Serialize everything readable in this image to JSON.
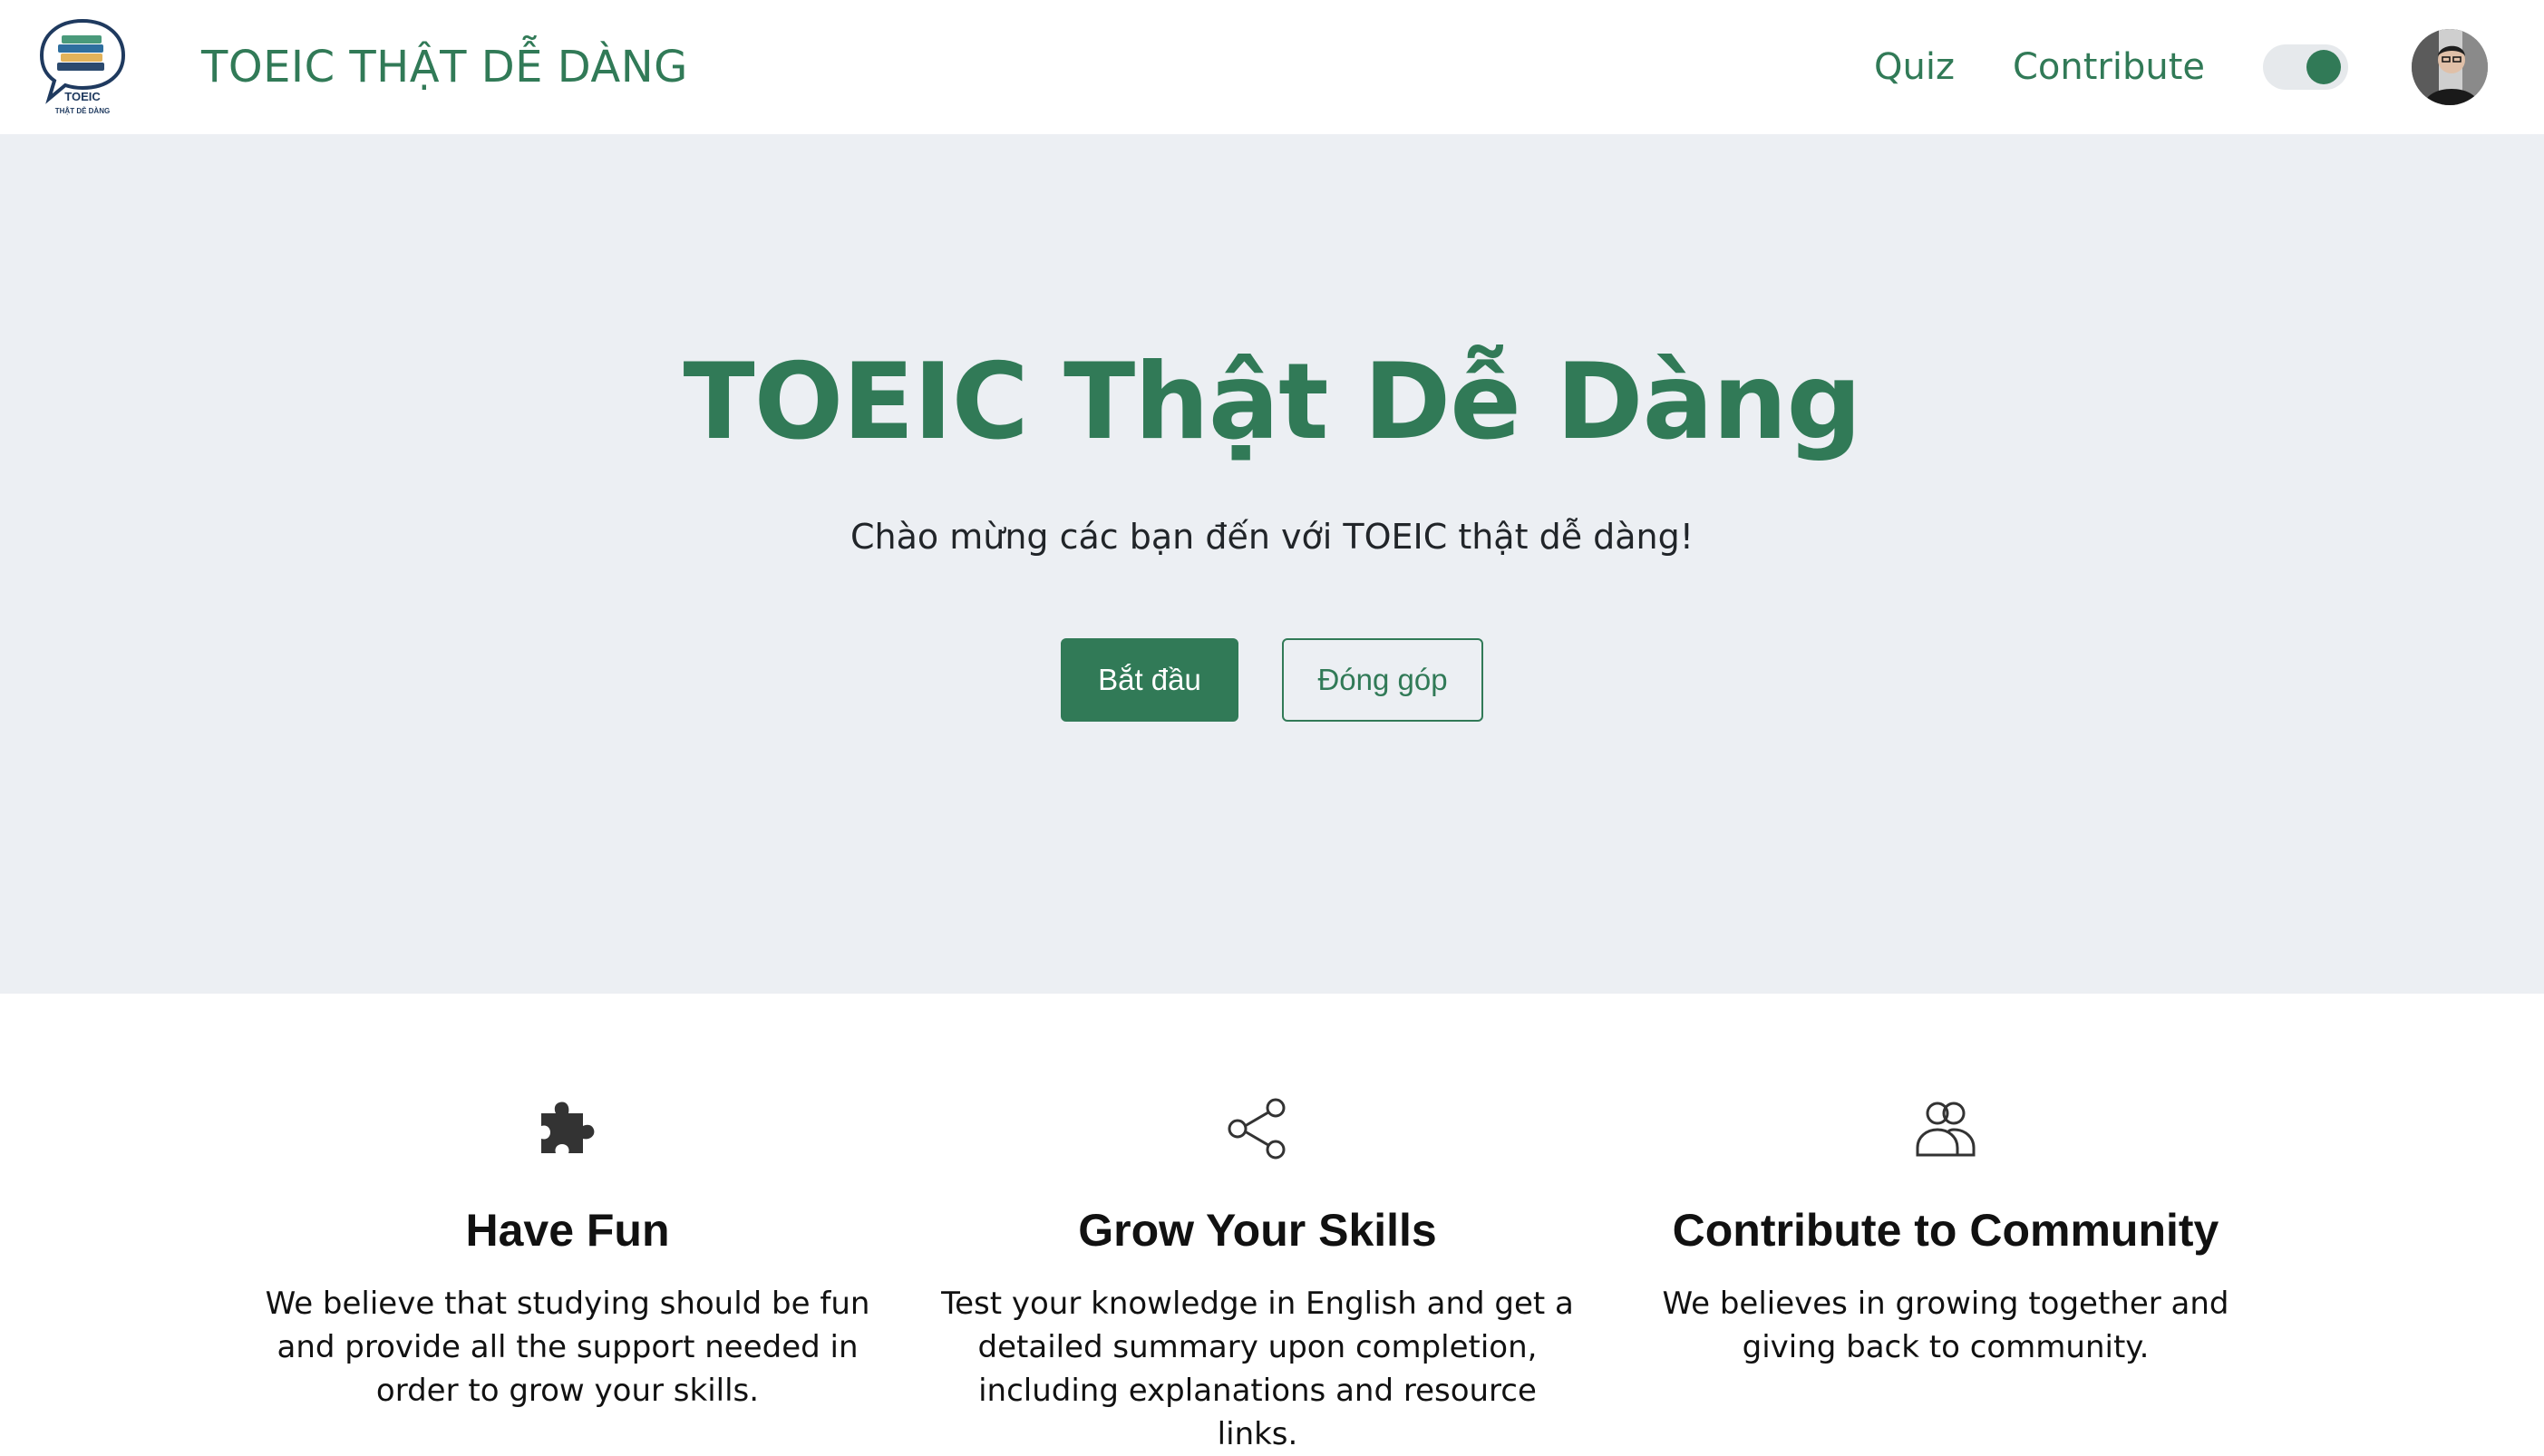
{
  "navbar": {
    "logo_text_top": "TOEIC",
    "logo_text_bottom": "THẬT DỄ DÀNG",
    "brand_title": "TOEIC THẬT DỄ DÀNG",
    "links": {
      "quiz": "Quiz",
      "contribute": "Contribute"
    },
    "theme_toggle_on": true,
    "accent_color": "#317a57"
  },
  "hero": {
    "title": "TOEIC Thật Dễ Dàng",
    "subtitle": "Chào mừng các bạn đến với TOEIC thật dễ dàng!",
    "primary_button": "Bắt đầu",
    "secondary_button": "Đóng góp",
    "background_color": "#eceff3"
  },
  "features": [
    {
      "icon": "puzzle-icon",
      "title": "Have Fun",
      "text": "We believe that studying should be fun and provide all the support needed in order to grow your skills."
    },
    {
      "icon": "share-icon",
      "title": "Grow Your Skills",
      "text": "Test your knowledge in English and get a detailed summary upon completion, including explanations and resource links."
    },
    {
      "icon": "people-icon",
      "title": "Contribute to Community",
      "text": "We believes in growing together and giving back to community."
    }
  ]
}
